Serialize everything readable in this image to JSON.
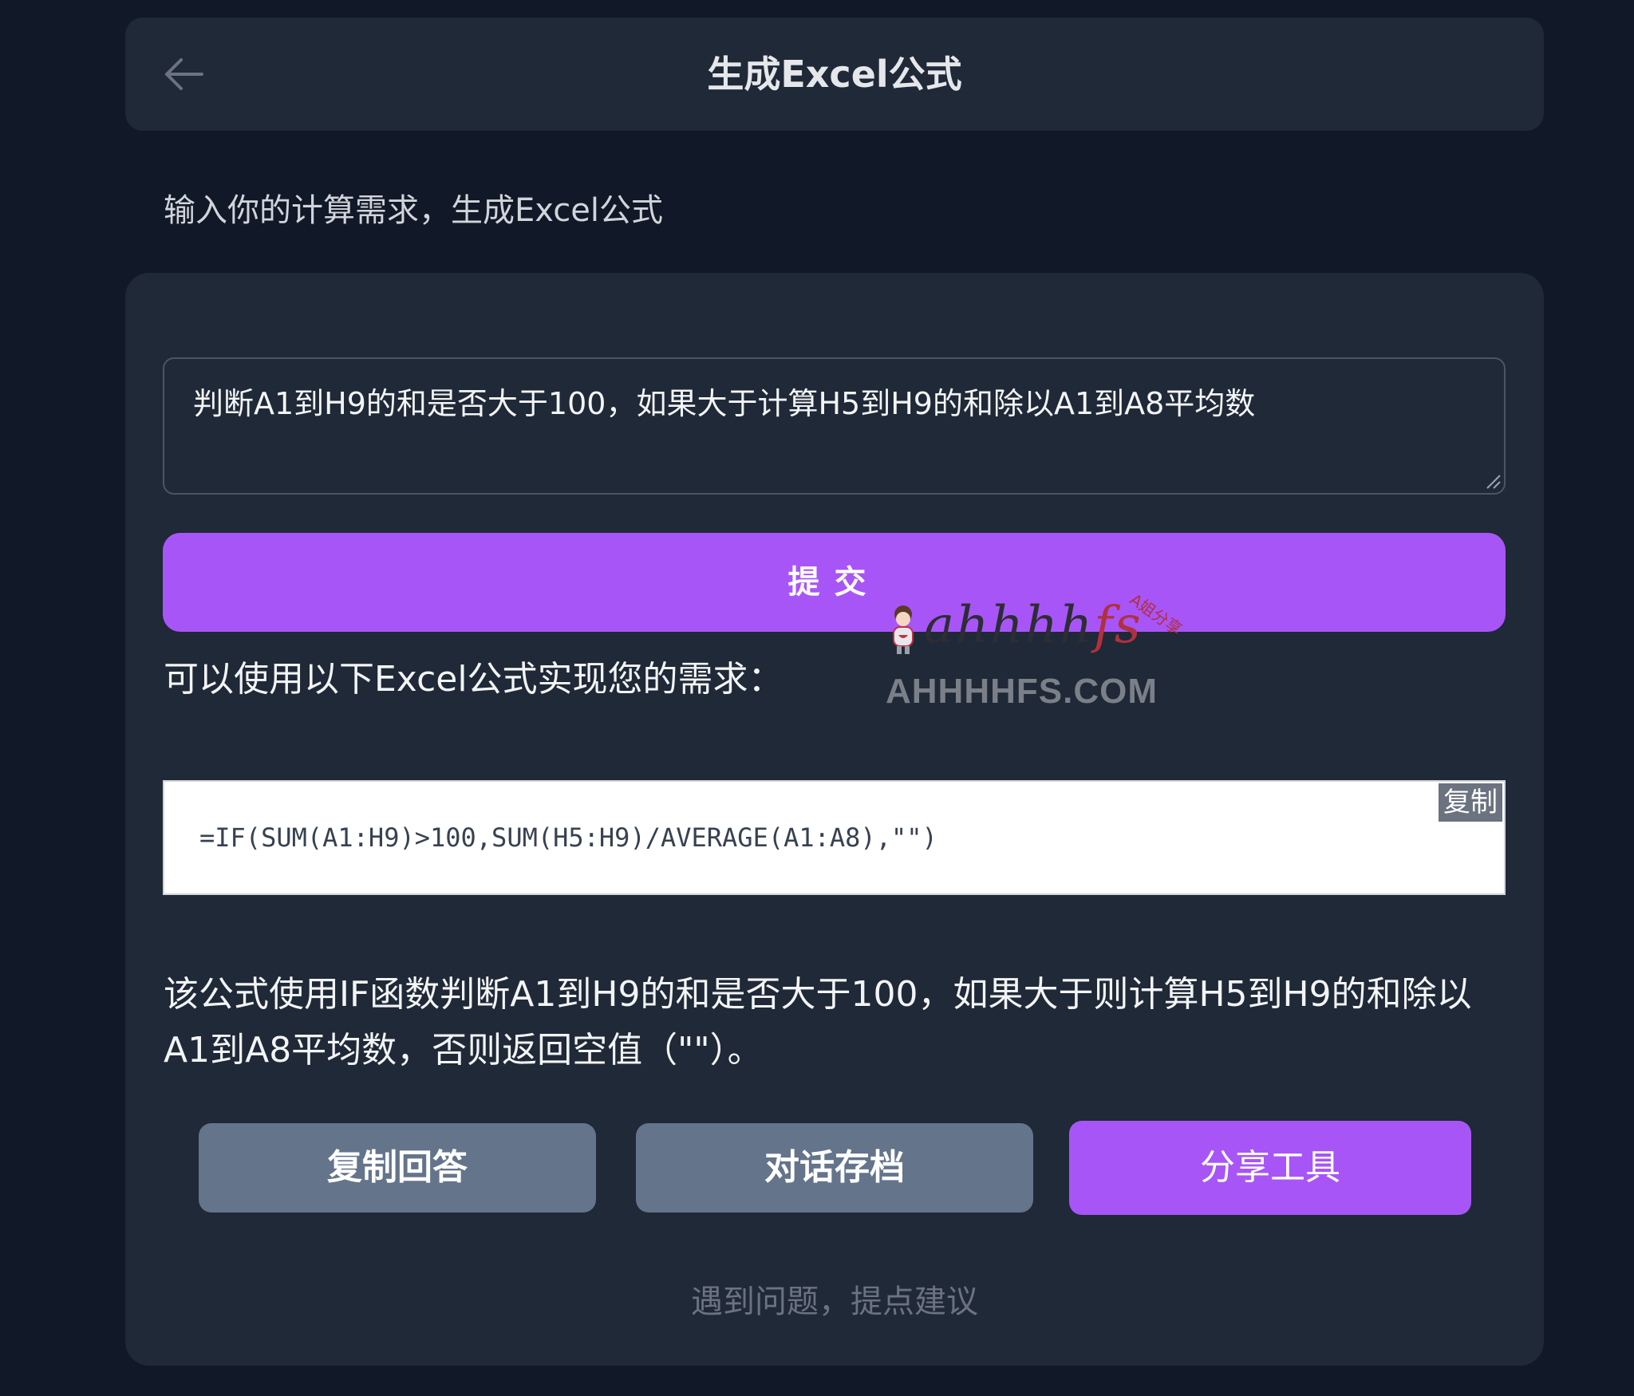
{
  "header": {
    "title": "生成Excel公式",
    "back_icon": "arrow-left-icon"
  },
  "subtitle": "输入你的计算需求，生成Excel公式",
  "form": {
    "input_value": "判断A1到H9的和是否大于100，如果大于计算H5到H9的和除以A1到A8平均数",
    "submit_label": "提交"
  },
  "result": {
    "intro": "可以使用以下Excel公式实现您的需求：",
    "formula": "=IF(SUM(A1:H9)>100,SUM(H5:H9)/AVERAGE(A1:A8),\"\")",
    "copy_code_label": "复制",
    "explanation": "该公式使用IF函数判断A1到H9的和是否大于100，如果大于则计算H5到H9的和除以A1到A8平均数，否则返回空值（\"\"）。"
  },
  "watermark": {
    "logo_text": "ahhhh",
    "logo_text_accent": "fs",
    "tag": "A姐分享",
    "domain": "AHHHHFS.COM"
  },
  "actions": {
    "copy_answer": "复制回答",
    "archive": "对话存档",
    "share": "分享工具"
  },
  "feedback": "遇到问题，提点建议",
  "colors": {
    "background": "#111827",
    "card": "#1f2937",
    "accent": "#a855f7",
    "secondary_button": "#64748b"
  }
}
